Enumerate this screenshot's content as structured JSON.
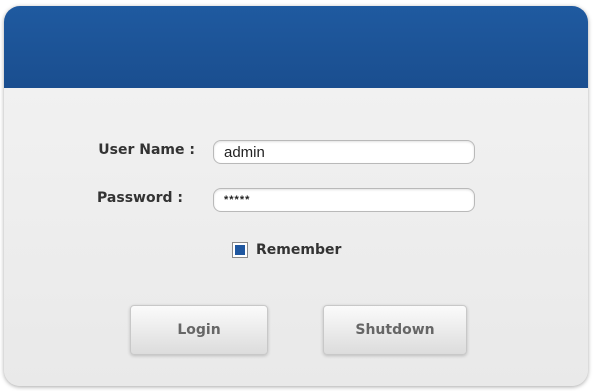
{
  "form": {
    "username_label": "User Name :",
    "username_value": "admin",
    "password_label": "Password :",
    "password_value": "*****",
    "remember_label": "Remember",
    "remember_checked": true
  },
  "buttons": {
    "login_label": "Login",
    "shutdown_label": "Shutdown"
  },
  "colors": {
    "header": "#1a4e8f",
    "checkbox_fill": "#1f57a0",
    "panel_background": "#eeeeee"
  }
}
